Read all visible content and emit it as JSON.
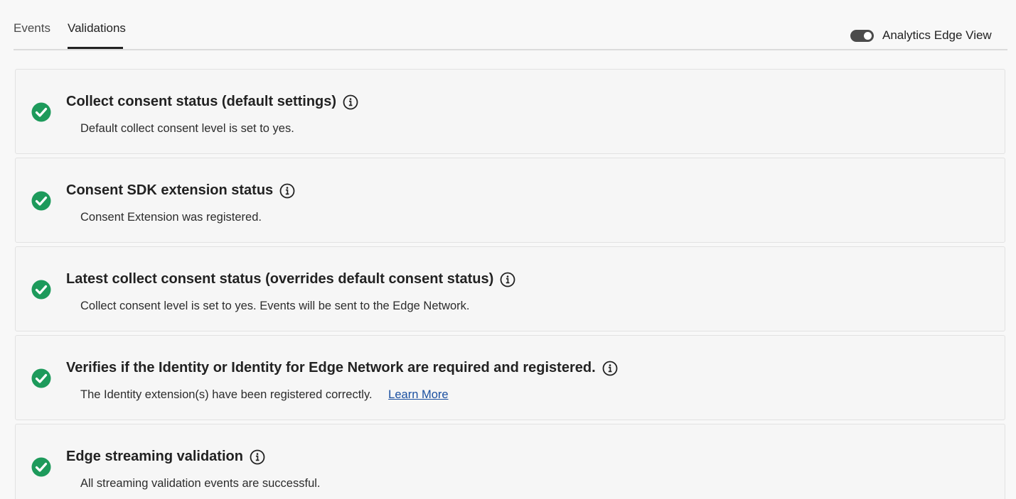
{
  "tabs": [
    {
      "label": "Events",
      "selected": false
    },
    {
      "label": "Validations",
      "selected": true
    }
  ],
  "toggle": {
    "label": "Analytics Edge View",
    "on": true
  },
  "colors": {
    "success": "#1d9a5b",
    "link": "#1a4fa0",
    "toggle_on": "#4b4b4b"
  },
  "validations": [
    {
      "status": "success",
      "status_icon": "check-circle-icon",
      "title": "Collect consent status (default settings)",
      "description": "Default collect consent level is set to yes."
    },
    {
      "status": "success",
      "status_icon": "check-circle-icon",
      "title": "Consent SDK extension status",
      "description": "Consent Extension was registered."
    },
    {
      "status": "success",
      "status_icon": "check-circle-icon",
      "title": "Latest collect consent status (overrides default consent status)",
      "description": "Collect consent level is set to yes. Events will be sent to the Edge Network."
    },
    {
      "status": "success",
      "status_icon": "check-circle-icon",
      "title": "Verifies if the Identity or Identity for Edge Network are required and registered.",
      "description": "The Identity extension(s) have been registered correctly.",
      "link": "Learn More"
    },
    {
      "status": "success",
      "status_icon": "check-circle-icon",
      "title": "Edge streaming validation",
      "description": "All streaming validation events are successful."
    }
  ]
}
